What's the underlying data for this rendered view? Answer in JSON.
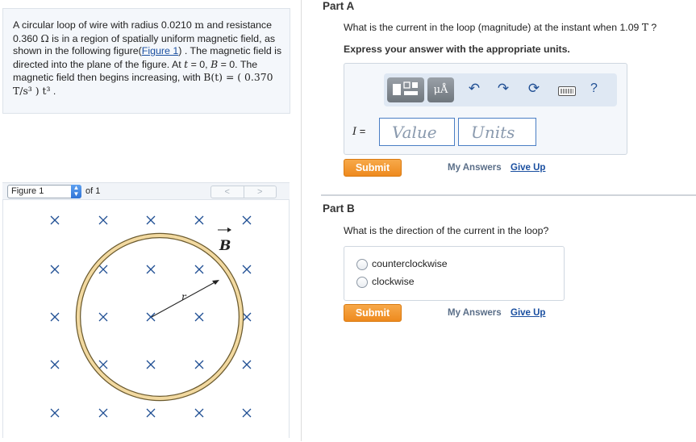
{
  "problem": {
    "t1": "A circular loop of wire with radius 0.0210 ",
    "u1": "m",
    "t2": " and resistance 0.360 ",
    "u2": "Ω",
    "t3": " is in a region of spatially uniform magnetic field, as shown in the following figure(",
    "link": "Figure 1",
    "t4": ") . The magnetic field is directed into the plane of the figure. At ",
    "v_t": "t",
    "t5": " = 0, ",
    "v_B": "B",
    "t6": " = 0. The magnetic field then begins increasing, with ",
    "formula": "B(t) = ( 0.370 T/s³ ) t³",
    "t7": " ."
  },
  "figure_panel": {
    "select_value": "Figure 1",
    "of_label": "of 1",
    "prev": "<",
    "next": ">",
    "field_label": "B",
    "radius_label": "r"
  },
  "part_a": {
    "title": "Part A",
    "question": "What is the current in the loop (magnitude) at the instant when 1.09 ",
    "question_unit": "T",
    "question_end": " ?",
    "instruction": "Express your answer with the appropriate units.",
    "toolbar": {
      "units_button": "μÅ",
      "icons": [
        "templates-icon",
        "units-icon",
        "undo-icon",
        "redo-icon",
        "reset-icon",
        "keyboard-icon",
        "help-icon"
      ],
      "help_label": "?"
    },
    "variable": "I",
    "equals": " =",
    "value_placeholder": "Value",
    "units_placeholder": "Units",
    "submit": "Submit",
    "my_answers": "My Answers",
    "give_up": "Give Up"
  },
  "part_b": {
    "title": "Part B",
    "question": "What is the direction of the current in the loop?",
    "options": [
      "counterclockwise",
      "clockwise"
    ],
    "submit": "Submit",
    "my_answers": "My Answers",
    "give_up": "Give Up"
  },
  "colors": {
    "submit": "#ee8a1e",
    "link": "#1a4fa0",
    "field_marks": "#1f4e93",
    "loop": "#f2d9a0"
  }
}
